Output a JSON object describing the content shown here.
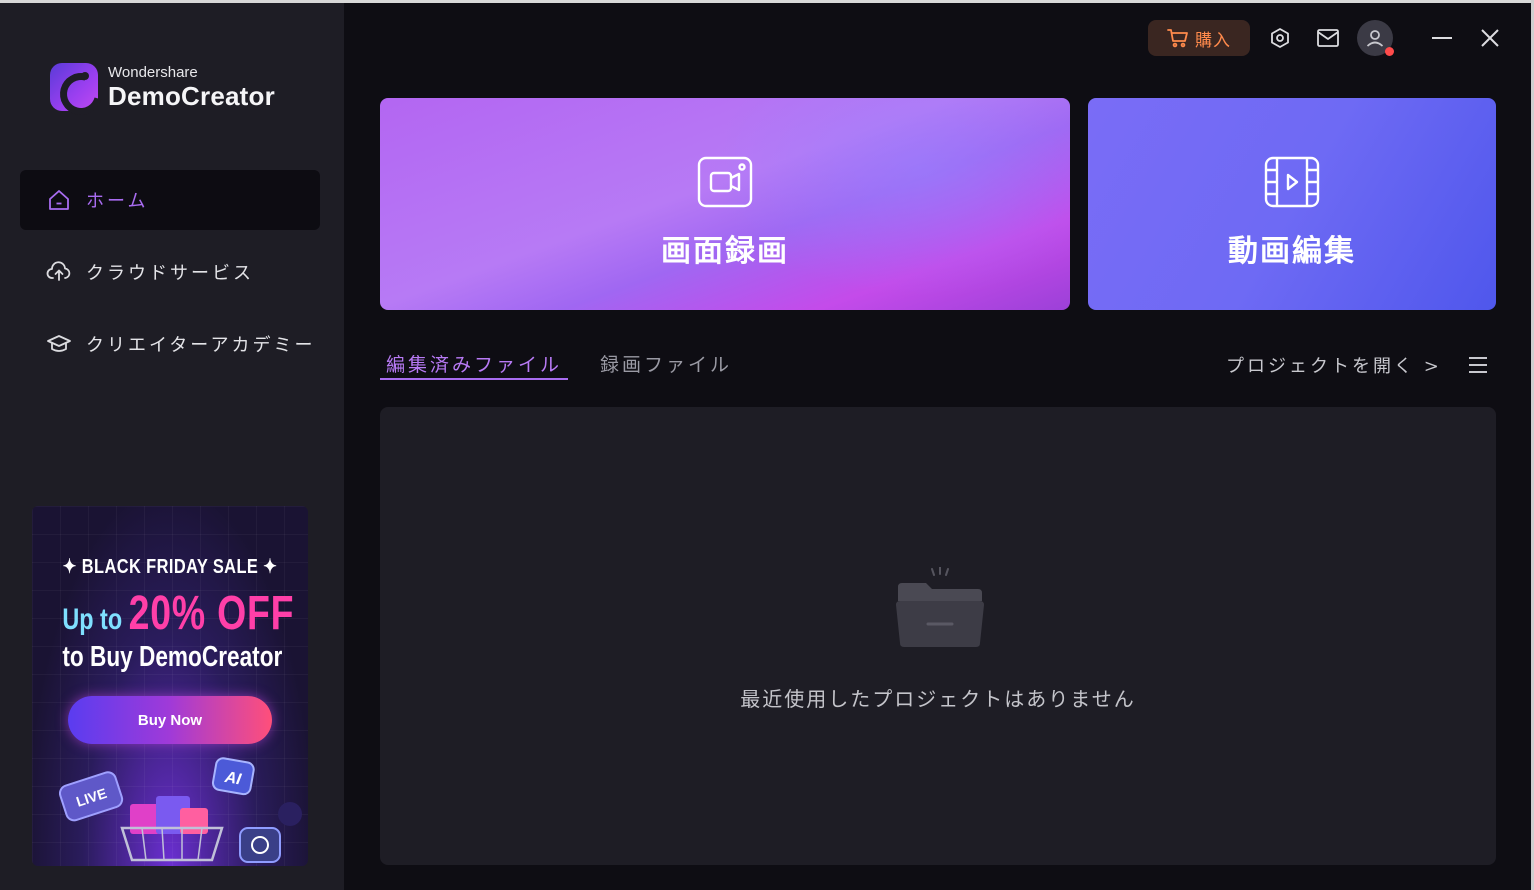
{
  "brand": {
    "small": "Wondershare",
    "big": "DemoCreator"
  },
  "nav": {
    "items": [
      {
        "label": "ホーム",
        "icon": "home-icon",
        "active": true
      },
      {
        "label": "クラウドサービス",
        "icon": "cloud-upload-icon",
        "active": false
      },
      {
        "label": "クリエイターアカデミー",
        "icon": "academy-cap-icon",
        "active": false
      }
    ]
  },
  "promo": {
    "sale": "✦ BLACK FRIDAY SALE ✦",
    "upto": "Up to ",
    "off": "20% OFF",
    "line3": "to Buy DemoCreator",
    "button": "Buy Now",
    "deco": {
      "live": "LIVE",
      "ai": "AI"
    }
  },
  "topbar": {
    "buy_label": "購入",
    "icons": [
      "cart-icon",
      "settings-icon",
      "mail-icon",
      "user-icon",
      "minimize-icon",
      "close-icon"
    ]
  },
  "cards": {
    "record": {
      "label": "画面録画"
    },
    "edit": {
      "label": "動画編集"
    }
  },
  "tabs": [
    {
      "label": "編集済みファイル",
      "active": true
    },
    {
      "label": "録画ファイル",
      "active": false
    }
  ],
  "open_project": "プロジェクトを開く >",
  "empty_state": "最近使用したプロジェクトはありません",
  "colors": {
    "accent": "#a86cf0",
    "buy": "#ff8a4c",
    "sidebar_bg": "#1e1d25",
    "main_bg": "#0e0d13"
  }
}
